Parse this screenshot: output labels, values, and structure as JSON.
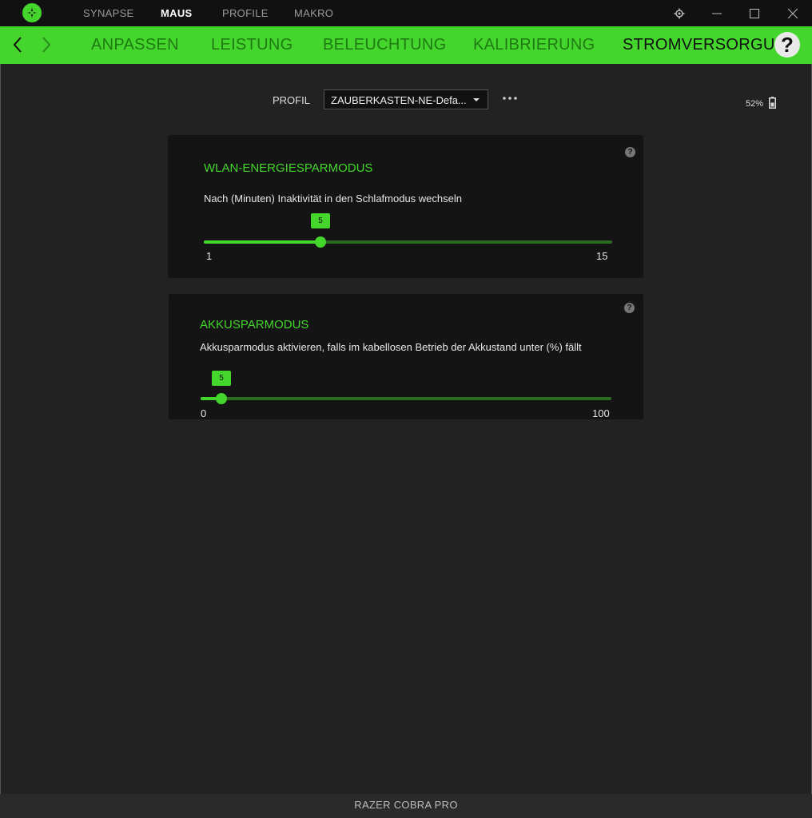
{
  "topnav": {
    "items": [
      "SYNAPSE",
      "MAUS",
      "PROFILE",
      "MAKRO"
    ],
    "active": "MAUS"
  },
  "subnav": {
    "items": [
      "ANPASSEN",
      "LEISTUNG",
      "BELEUCHTUNG",
      "KALIBRIERUNG",
      "STROMVERSORGUNG"
    ],
    "active": "STROMVERSORGUNG"
  },
  "help": {
    "label": "?"
  },
  "profile": {
    "label": "PROFIL",
    "value": "ZAUBERKASTEN-NE-Defa..."
  },
  "battery": {
    "percent": "52%"
  },
  "wlan": {
    "title": "WLAN-ENERGIESPARMODUS",
    "description": "Nach (Minuten) Inaktivität in den Schlafmodus wechseln",
    "min": "1",
    "max": "15",
    "value": "5",
    "min_num": 1,
    "max_num": 15,
    "value_num": 5
  },
  "akku": {
    "title": "AKKUSPARMODUS",
    "description": "Akkusparmodus aktivieren, falls im kabellosen Betrieb der Akkustand unter (%) fällt",
    "min": "0",
    "max": "100",
    "value": "5",
    "min_num": 0,
    "max_num": 100,
    "value_num": 5
  },
  "card_help": "?",
  "footer": {
    "device": "RAZER COBRA PRO"
  },
  "colors": {
    "accent": "#44d62c",
    "background": "#222222",
    "card": "#141414",
    "titlebar": "#111111"
  },
  "icons": [
    "razer-logo-icon",
    "settings-icon",
    "minimize-icon",
    "maximize-icon",
    "close-icon",
    "back-arrow-icon",
    "forward-arrow-icon",
    "help-icon",
    "dropdown-caret-icon",
    "more-options-icon",
    "battery-icon"
  ]
}
